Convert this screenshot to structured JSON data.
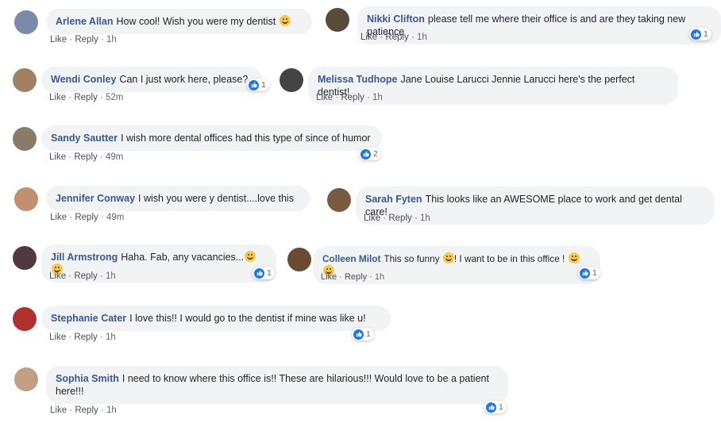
{
  "actions": {
    "like": "Like",
    "reply": "Reply",
    "sep": " · "
  },
  "colors": {
    "name": "#385898",
    "bubble": "#f2f3f5",
    "like": "#1877f2"
  },
  "comments": [
    {
      "name": "Arlene Allan",
      "text": "How cool! Wish you were my dentist",
      "emoji": [
        "smiling-face"
      ],
      "time": "1h",
      "avatar": "#7b8aa8"
    },
    {
      "name": "Nikki Clifton",
      "text": "please tell me where their office is and are they taking new patience",
      "time": "1h",
      "likes": "1",
      "avatar": "#5a4a3a"
    },
    {
      "name": "Wendi Conley",
      "text": "Can I just work here, please?",
      "time": "52m",
      "likes": "1",
      "avatar": "#a08060"
    },
    {
      "name": "Melissa Tudhope",
      "text": "Jane Louise Larucci Jennie Larucci here's the perfect dentist!",
      "time": "1h",
      "avatar": "#444444"
    },
    {
      "name": "Sandy Sautter",
      "text": "I wish more dental offices had this type of since of humor",
      "time": "49m",
      "likes": "2",
      "avatar": "#8a7a6a"
    },
    {
      "name": "Jennifer Conway",
      "text": "I wish you were y dentist....love this",
      "time": "49m",
      "avatar": "#c09070"
    },
    {
      "name": "Sarah Fyten",
      "text": "This looks like an AWESOME place to work and get dental care!",
      "time": "1h",
      "avatar": "#7a5a40"
    },
    {
      "name": "Jill Armstrong",
      "text": "Haha. Fab, any vacancies...",
      "emoji": [
        "laughing-face",
        "laughing-face"
      ],
      "time": "1h",
      "likes": "1",
      "avatar": "#503a40"
    },
    {
      "name": "Colleen Milot",
      "text": "This so funny",
      "text2": "! I want to be in this office !",
      "emoji": [
        "laughing-face"
      ],
      "emoji2": [
        "laughing-face",
        "laughing-face"
      ],
      "time": "1h",
      "likes": "1",
      "avatar": "#6a4a30"
    },
    {
      "name": "Stephanie Cater",
      "text": "I love this!! I would go to the dentist if mine was like u!",
      "time": "1h",
      "likes": "1",
      "avatar": "#b03030"
    },
    {
      "name": "Sophia Smith",
      "text": "I need to know where this office is!! These are hilarious!!! Would love to be a patient here!!!",
      "time": "1h",
      "likes": "1",
      "avatar": "#c0a080"
    }
  ]
}
